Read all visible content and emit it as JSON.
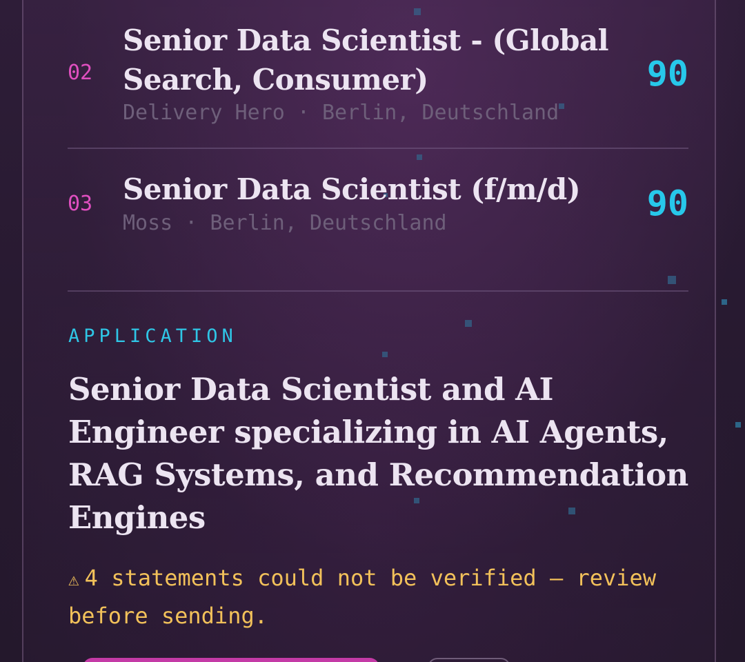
{
  "jobs": [
    {
      "rank": "02",
      "title": "Senior Data Scientist - (Global Search, Consumer)",
      "meta": "Delivery Hero · Berlin, Deutschland",
      "score": "90"
    },
    {
      "rank": "03",
      "title": "Senior Data Scientist (f/m/d)",
      "meta": "Moss · Berlin, Deutschland",
      "score": "90"
    }
  ],
  "application": {
    "label": "APPLICATION",
    "headline": "Senior Data Scientist and AI Engineer specializing in AI Agents, RAG Systems, and Recommendation Engines",
    "warning_icon": "⚠",
    "warning_text": "4 statements could not be verified — review before sending."
  },
  "colors": {
    "accent_cyan": "#27c8ea",
    "accent_magenta": "#e04fc0",
    "warning_yellow": "#f2c15a",
    "background": "#281a31"
  }
}
